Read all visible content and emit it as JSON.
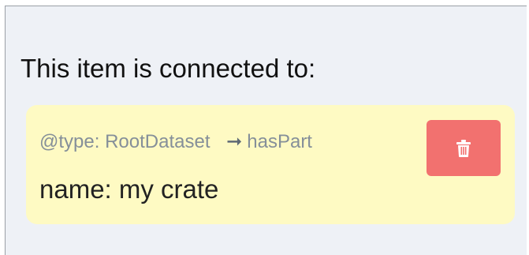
{
  "section": {
    "heading": "This item is connected to:"
  },
  "connection": {
    "type_prefix": "@type:",
    "type_value": "RootDataset",
    "arrow": "➞",
    "property": "hasPart",
    "name_prefix": "name:",
    "name_value": "my crate",
    "delete_icon": "trash-icon"
  },
  "colors": {
    "panel_bg": "#eef1f6",
    "card_bg": "#fefac3",
    "delete_bg": "#f2716f",
    "meta_text": "#858f99"
  }
}
